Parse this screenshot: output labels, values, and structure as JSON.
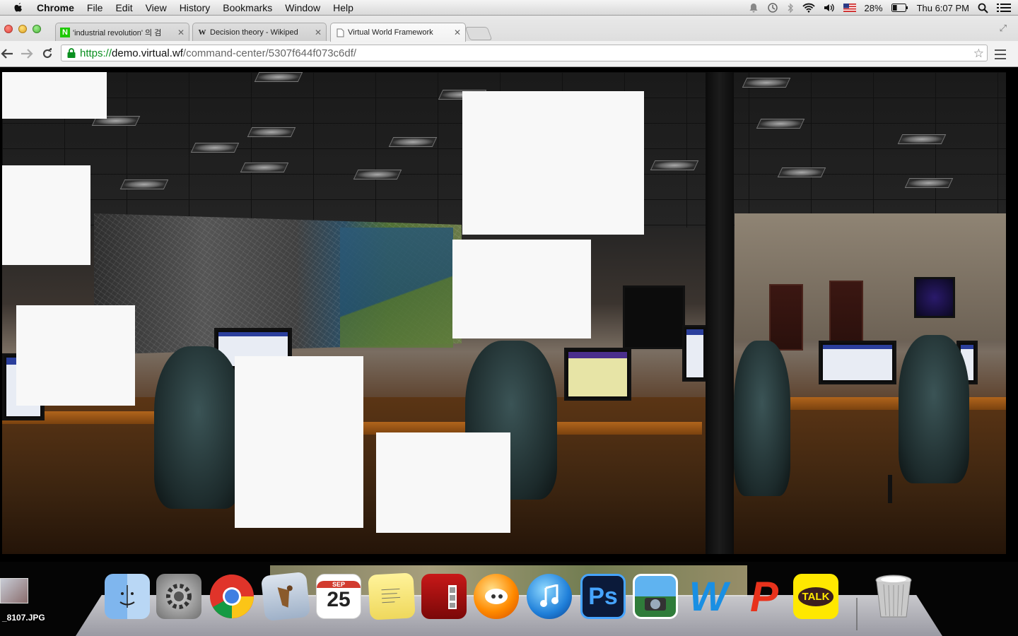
{
  "menubar": {
    "app_name": "Chrome",
    "menus": [
      "File",
      "Edit",
      "View",
      "History",
      "Bookmarks",
      "Window",
      "Help"
    ],
    "battery": "28%",
    "clock": "Thu 6:07 PM",
    "status_icons": [
      "notifications-icon",
      "time-machine-icon",
      "bluetooth-icon",
      "wifi-icon",
      "volume-icon",
      "us-flag-icon",
      "battery-icon",
      "spotlight-icon",
      "notification-center-icon"
    ]
  },
  "browser": {
    "tabs": [
      {
        "title": "'industrial revolution' 의 검",
        "favicon": "N",
        "favicon_color": "#1ec800"
      },
      {
        "title": "Decision theory - Wikiped",
        "favicon": "W",
        "favicon_color": "#ffffff"
      },
      {
        "title": "Virtual World Framework",
        "favicon": "page",
        "favicon_color": "#ffffff"
      }
    ],
    "active_tab": 2,
    "url_scheme": "https://",
    "url_host": "demo.virtual.wf",
    "url_path": "/command-center/5307f644f073c6df/"
  },
  "desktop": {
    "file_label": "_8107.JPG"
  },
  "dock": {
    "items": [
      "Finder",
      "System Preferences",
      "Chrome",
      "Mail",
      "Calendar",
      "Stickies",
      "Photo Booth",
      "Growl",
      "iTunes",
      "Photoshop",
      "iPhoto",
      "Word",
      "PowerPoint",
      "KakaoTalk",
      "Trash"
    ],
    "calendar_month": "SEP",
    "calendar_day": "25",
    "photoshop_label": "Ps",
    "kakao_label": "TALK"
  },
  "colors": {
    "url_green": "#0a8f1f",
    "naver_green": "#1ec800",
    "kakao_yellow": "#ffe800"
  }
}
